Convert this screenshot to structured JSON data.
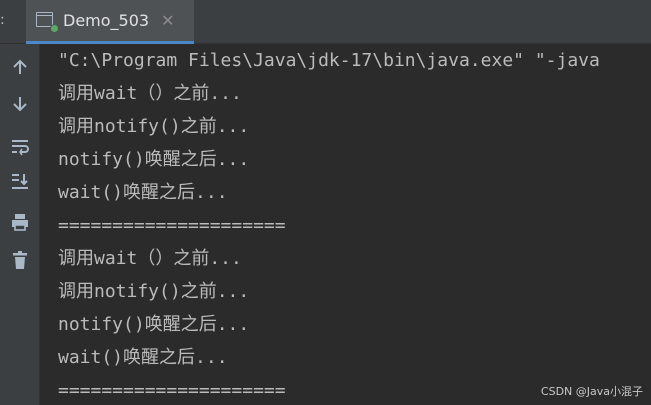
{
  "tabbar": {
    "prefix": ":",
    "tab": {
      "title": "Demo_503",
      "close_glyph": "✕",
      "icon": "run-console-icon",
      "status_color": "#59a869"
    }
  },
  "toolbar": {
    "buttons": [
      {
        "name": "scroll-up-button",
        "icon": "arrow-up-icon"
      },
      {
        "name": "scroll-down-button",
        "icon": "arrow-down-icon"
      },
      {
        "name": "soft-wrap-button",
        "icon": "soft-wrap-icon"
      },
      {
        "name": "scroll-to-end-button",
        "icon": "scroll-to-end-icon"
      },
      {
        "name": "print-button",
        "icon": "printer-icon"
      },
      {
        "name": "clear-all-button",
        "icon": "trash-icon"
      }
    ]
  },
  "console": {
    "lines": [
      "\"C:\\Program Files\\Java\\jdk-17\\bin\\java.exe\" \"-java",
      "调用wait（）之前...",
      "调用notify()之前...",
      "notify()唤醒之后...",
      "wait()唤醒之后...",
      "=====================",
      "调用wait（）之前...",
      "调用notify()之前...",
      "notify()唤醒之后...",
      "wait()唤醒之后...",
      "====================="
    ]
  },
  "watermark": "CSDN @Java小混子",
  "colors": {
    "background": "#2b2b2b",
    "panel": "#3c3f41",
    "text": "#bbbbbb",
    "accent": "#4a88c7"
  }
}
